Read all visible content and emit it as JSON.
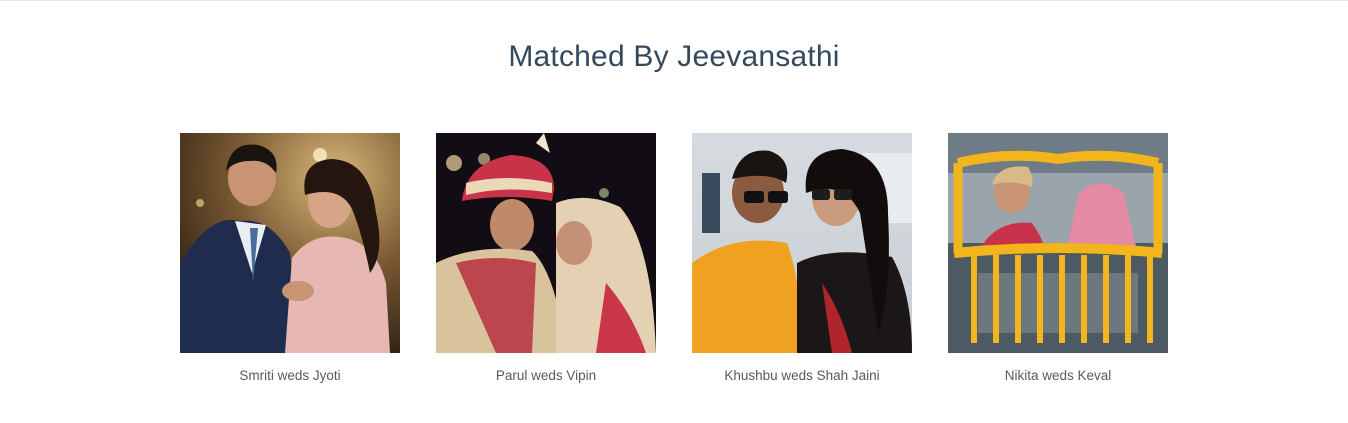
{
  "section": {
    "title": "Matched By Jeevansathi"
  },
  "stories": [
    {
      "caption": "Smriti weds Jyoti"
    },
    {
      "caption": "Parul weds Vipin"
    },
    {
      "caption": "Khushbu weds Shah Jaini"
    },
    {
      "caption": "Nikita weds Keval"
    }
  ]
}
